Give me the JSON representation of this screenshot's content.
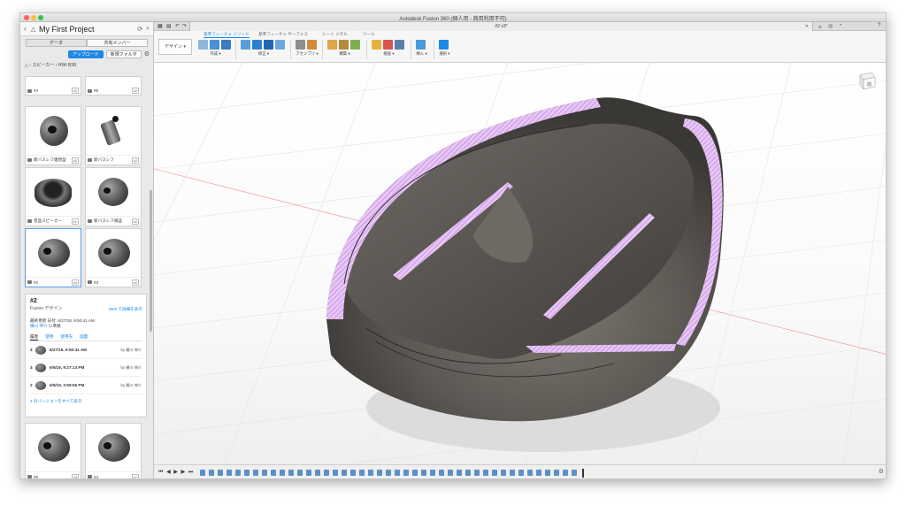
{
  "window": {
    "title": "Autodesk Fusion 360 (個人用 - 商用利用不可)"
  },
  "data_panel": {
    "project_name": "My First Project",
    "tabs": [
      {
        "label": "データ"
      },
      {
        "label": "共有メンバー"
      }
    ],
    "upload_label": "アップロード",
    "new_folder_label": "新規フォルダ",
    "breadcrumb_parent": "スピーカー",
    "breadcrumb_current": "HWI B3R",
    "cards": [
      {
        "name": "#4",
        "version": "v2"
      },
      {
        "name": "#5",
        "version": "v2"
      },
      {
        "name": "新バスレフ連続型",
        "version": "v2"
      },
      {
        "name": "新バスレフ",
        "version": "v2"
      },
      {
        "name": "普品スピーカー",
        "version": "v1"
      },
      {
        "name": "新バスレフ検証",
        "version": "v2"
      },
      {
        "name": "#2",
        "version": "v4"
      },
      {
        "name": "#3",
        "version": "v2"
      },
      {
        "name": "#5",
        "version": "v3"
      },
      {
        "name": "#4",
        "version": "v7"
      }
    ],
    "detail": {
      "name": "#2",
      "type": "Fusion デザイン",
      "web_link": "Web で詳細を表示",
      "modified": "最終更新 日付: 6/27/19, 9:50:41 AM",
      "author": "横川 伸介",
      "author_suffix": "に準拠",
      "tabs": [
        {
          "label": "履歴"
        },
        {
          "label": "使用"
        },
        {
          "label": "使用先"
        },
        {
          "label": "図面"
        }
      ],
      "versions": [
        {
          "num": "4",
          "date": "6/27/19, 9:50:41 AM",
          "by": "by 横川 伸介"
        },
        {
          "num": "3",
          "date": "6/5/19, 9:27:14 PM",
          "by": "by 横川 伸介"
        },
        {
          "num": "2",
          "date": "6/5/19, 3:59:55 PM",
          "by": "by 横川 伸介"
        }
      ],
      "show_all": "4 のバージョンをすべて表示"
    }
  },
  "document": {
    "tab_title": "#2 v3*"
  },
  "ribbon": {
    "workspace": "デザイン ▾",
    "tabs": [
      {
        "label": "基準フィーチャ ソリッド"
      },
      {
        "label": "基準フィーチャ サーフェス"
      },
      {
        "label": "シート メタル"
      },
      {
        "label": "ツール"
      }
    ],
    "groups": [
      {
        "label": "作成 ▾"
      },
      {
        "label": "修正 ▾"
      },
      {
        "label": "アセンブリ ▾"
      },
      {
        "label": "構築 ▾"
      },
      {
        "label": "検査 ▾"
      },
      {
        "label": "挿入 ▾"
      },
      {
        "label": "選択 ▾"
      }
    ]
  },
  "viewcube": {
    "face": "前"
  },
  "colors": {
    "accent": "#1e88e5",
    "section_fill": "#d59ef0",
    "model": "#5c5853"
  }
}
